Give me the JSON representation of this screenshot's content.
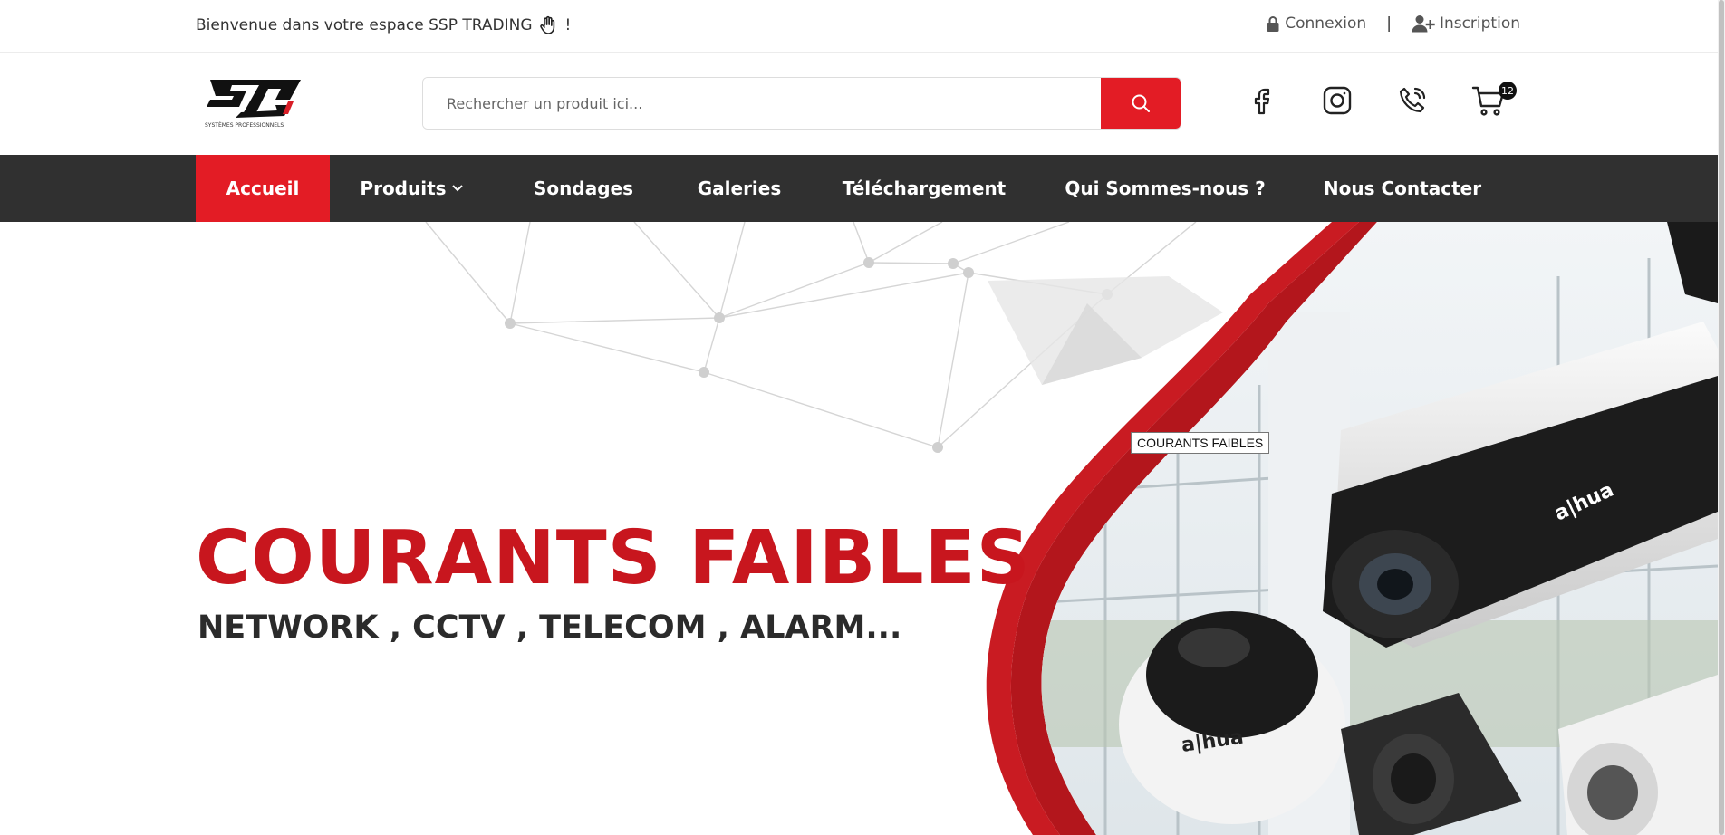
{
  "topbar": {
    "welcome_text": "Bienvenue dans votre espace SSP TRADING",
    "welcome_suffix": "!",
    "login_label": "Connexion",
    "separator": "|",
    "register_label": "Inscription"
  },
  "header": {
    "logo_caption": "SYSTÈMES PROFESSIONNELS",
    "search_placeholder": "Rechercher un produit ici...",
    "cart_count": "12"
  },
  "nav": {
    "items": [
      {
        "label": "Accueil",
        "active": true
      },
      {
        "label": "Produits",
        "has_dropdown": true
      },
      {
        "label": "Sondages"
      },
      {
        "label": "Galeries"
      },
      {
        "label": "Téléchargement"
      },
      {
        "label": "Qui Sommes-nous ?"
      },
      {
        "label": "Nous Contacter"
      }
    ]
  },
  "hero": {
    "title": "COURANTS FAIBLES",
    "subtitle": "NETWORK , CCTV , TELECOM , ALARM...",
    "tooltip": "COURANTS FAIBLES",
    "camera_brand": "alhua"
  },
  "colors": {
    "accent": "#e31c25",
    "nav_bg": "#303030",
    "hero_title": "#c8161e"
  },
  "icons": [
    "hand-wave-icon",
    "lock-icon",
    "user-plus-icon",
    "search-icon",
    "facebook-icon",
    "instagram-icon",
    "phone-icon",
    "cart-icon",
    "chevron-down-icon"
  ]
}
